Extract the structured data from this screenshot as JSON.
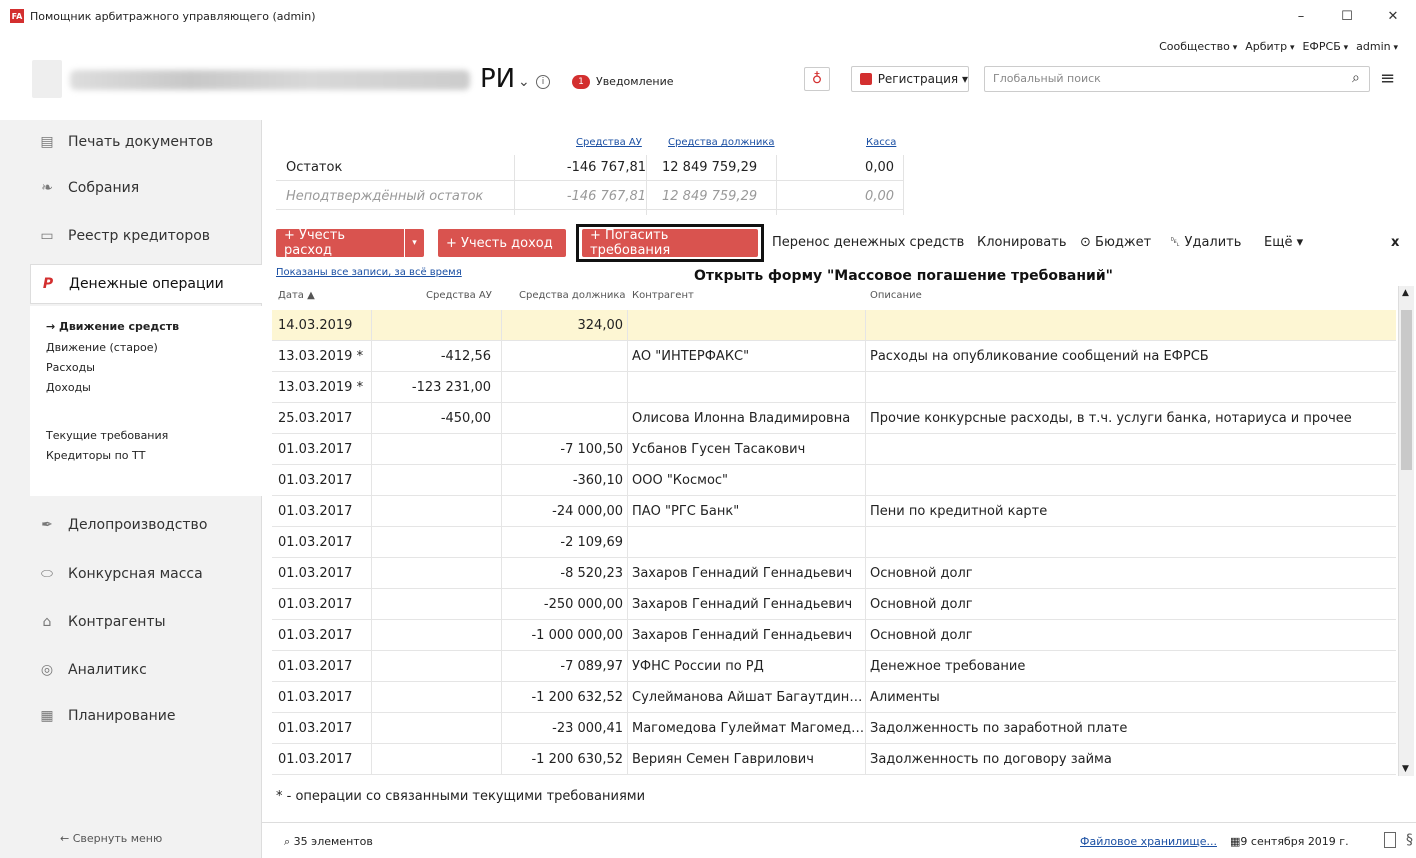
{
  "window": {
    "title": "Помощник арбитражного управляющего (admin)",
    "app_icon": "FA",
    "minimize": "–",
    "maximize": "☐",
    "close": "✕"
  },
  "topmenu": [
    "Сообщество",
    "Арбитр",
    "ЕФРСБ",
    "admin"
  ],
  "header": {
    "region": "РИ",
    "notif_count": "1",
    "notif_label": "Уведомление",
    "reg_label": "Регистрация",
    "search_placeholder": "Глобальный поиск"
  },
  "sidebar": {
    "items": [
      {
        "label": "Печать документов",
        "icon": "document-icon"
      },
      {
        "label": "Собрания",
        "icon": "handshake-icon"
      },
      {
        "label": "Реестр кредиторов",
        "icon": "registry-icon"
      },
      {
        "label": "Денежные операции",
        "icon": "money-icon"
      },
      {
        "label": "Делопроизводство",
        "icon": "paperclip-icon"
      },
      {
        "label": "Конкурсная масса",
        "icon": "bank-icon"
      },
      {
        "label": "Контрагенты",
        "icon": "building-icon"
      },
      {
        "label": "Аналитикс",
        "icon": "analytics-icon"
      },
      {
        "label": "Планирование",
        "icon": "calendar-icon"
      }
    ],
    "submenu": [
      "→ Движение средств",
      "Движение (старое)",
      "Расходы",
      "Доходы",
      "Текущие требования",
      "Кредиторы по ТТ"
    ],
    "collapse": "← Свернуть меню"
  },
  "balance": {
    "headers": [
      "Средства АУ",
      "Средства должника",
      "Касса"
    ],
    "rows": [
      {
        "label": "Остаток",
        "au": "-146 767,81",
        "dl": "12 849 759,29",
        "cash": "0,00"
      },
      {
        "label": "Неподтверждённый остаток",
        "au": "-146 767,81",
        "dl": "12 849 759,29",
        "cash": "0,00"
      }
    ]
  },
  "toolbar": {
    "expense": "+ Учесть расход",
    "income": "+ Учесть доход",
    "repay": "+ Погасить требования",
    "transfer": "Перенос денежных средств",
    "clone": "Клонировать",
    "budget": "Бюджет",
    "delete": "Удалить",
    "more": "Ещё",
    "close": "x"
  },
  "filter_note": "Показаны все записи, за всё время",
  "hint": "Открыть форму \"Массовое погашение требований\"",
  "table": {
    "headers": [
      "Дата ▲",
      "Средства АУ",
      "Средства должника",
      "Контрагент",
      "Описание"
    ],
    "rows": [
      [
        "14.03.2019",
        "",
        "324,00",
        "",
        ""
      ],
      [
        "13.03.2019 *",
        "-412,56",
        "",
        "АО \"ИНТЕРФАКС\"",
        "Расходы на опубликование сообщений на ЕФРСБ"
      ],
      [
        "13.03.2019 *",
        "-123 231,00",
        "",
        "",
        ""
      ],
      [
        "25.03.2017",
        "-450,00",
        "",
        "Олисова Илонна Владимировна",
        "Прочие конкурсные расходы, в т.ч. услуги банка,  нотариуса и прочее"
      ],
      [
        "01.03.2017",
        "",
        "-7 100,50",
        "Усбанов Гусен Тасакович",
        ""
      ],
      [
        "01.03.2017",
        "",
        "-360,10",
        "ООО \"Космос\"",
        ""
      ],
      [
        "01.03.2017",
        "",
        "-24 000,00",
        "ПАО \"РГС Банк\"",
        "Пени по кредитной карте"
      ],
      [
        "01.03.2017",
        "",
        "-2 109,69",
        "",
        ""
      ],
      [
        "01.03.2017",
        "",
        "-8 520,23",
        "Захаров Геннадий Геннадьевич",
        "Основной долг"
      ],
      [
        "01.03.2017",
        "",
        "-250 000,00",
        "Захаров Геннадий Геннадьевич",
        "Основной долг"
      ],
      [
        "01.03.2017",
        "",
        "-1 000 000,00",
        "Захаров Геннадий Геннадьевич",
        "Основной долг"
      ],
      [
        "01.03.2017",
        "",
        "-7 089,97",
        "УФНС России по РД",
        "Денежное требование"
      ],
      [
        "01.03.2017",
        "",
        "-1 200 632,52",
        "Сулейманова Айшат Багаутдиновна",
        "Алименты"
      ],
      [
        "01.03.2017",
        "",
        "-23 000,41",
        "Магомедова Гулеймат Магомедовна",
        "Задолженность по заработной плате"
      ],
      [
        "01.03.2017",
        "",
        "-1 200 630,52",
        "Вериян Семен Гаврилович",
        "Задолженность по договору займа"
      ]
    ]
  },
  "footnote": "* - операции со связанными текущими требованиями",
  "status": {
    "count": "35 элементов",
    "filestore": "Файловое хранилище...",
    "date": "9 сентября 2019 г."
  },
  "colors": {
    "accent": "#d9534f",
    "link": "#1a4fa3",
    "selected_row": "#fdf6d3"
  }
}
